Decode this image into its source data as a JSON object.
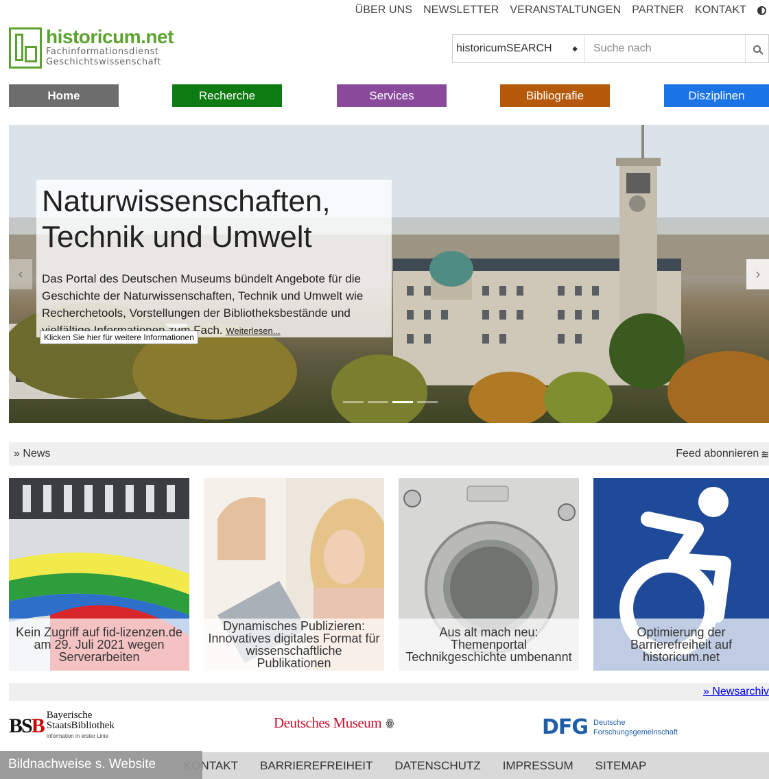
{
  "topnav": {
    "items": [
      "ÜBER UNS",
      "NEWSLETTER",
      "VERANSTALTUNGEN",
      "PARTNER",
      "KONTAKT"
    ],
    "contrast_icon": "contrast-icon"
  },
  "logo": {
    "title": "historicum.net",
    "line1": "Fachinformationsdienst",
    "line2": "Geschichtswissenschaft",
    "color": "#5ca22f"
  },
  "search": {
    "select_value": "historicumSEARCH",
    "placeholder": "Suche nach",
    "icon": "search-icon"
  },
  "main_tabs": [
    {
      "label": "Home",
      "color": "#6d6d6d"
    },
    {
      "label": "Recherche",
      "color": "#0d7a12"
    },
    {
      "label": "Services",
      "color": "#8a4a9c"
    },
    {
      "label": "Bibliografie",
      "color": "#b55a0b"
    },
    {
      "label": "Disziplinen",
      "color": "#1a74e6"
    }
  ],
  "hero": {
    "title_line1": "Naturwissenschaften,",
    "title_line2": "Technik und Umwelt",
    "text": "Das Portal des Deutschen Museums bündelt Angebote für die Geschichte der Naturwissenschaften, Technik und Umwelt wie Recherchetools, Vorstellungen der Bibliotheksbestände und vielfältige Informationen zum Fach.",
    "more": "Weiterlesen...",
    "tooltip": "Klicken Sie hier für weitere Informationen",
    "prev": "‹",
    "next": "›",
    "slide_count": 4,
    "active_slide": 3
  },
  "news": {
    "label": "» News",
    "feed": "Feed abonnieren",
    "feed_icon": "rss-icon",
    "items": [
      {
        "title": "Kein Zugriff auf fid-lizenzen.de am 29. Juli 2021 wegen Serverarbeiten"
      },
      {
        "title": "Dynamisches Publizieren: Innovatives digitales Format für wissenschaftliche Publikationen"
      },
      {
        "title": "Aus alt mach neu: Themenportal Technikgeschichte umbenannt"
      },
      {
        "title": "Optimierung der Barrierefreiheit auf historicum.net"
      }
    ],
    "archive": "» Newsarchiv"
  },
  "partners": {
    "bsb_l1": "Bayerische",
    "bsb_l2": "StaatsBibliothek",
    "bsb_l3": "Information in erster Linie",
    "dm": "Deutsches Museum",
    "dfg": "DFG",
    "dfg_l1": "Deutsche",
    "dfg_l2": "Forschungsgemeinschaft"
  },
  "footer": {
    "links": [
      "KONTAKT",
      "BARRIEREFREIHEIT",
      "DATENSCHUTZ",
      "IMPRESSUM",
      "SITEMAP"
    ],
    "credit": "Bildnachweise s. Website"
  }
}
